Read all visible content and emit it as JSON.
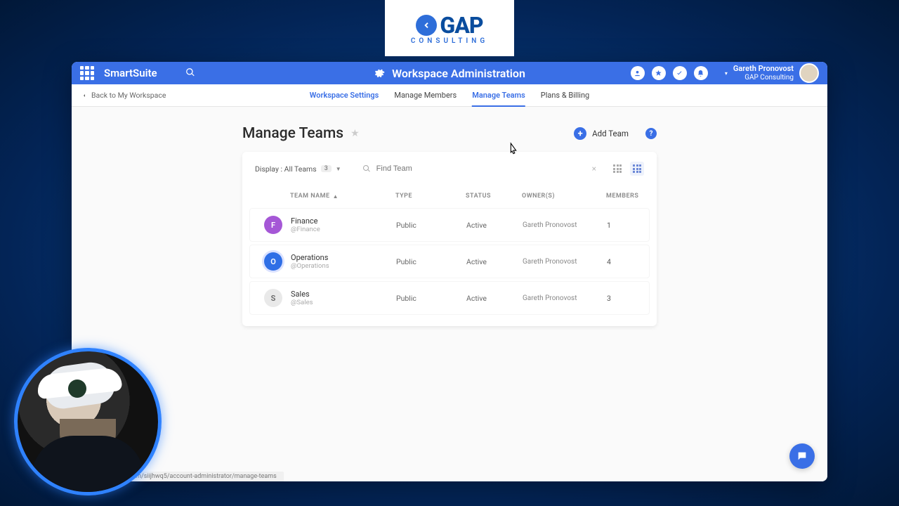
{
  "logo": {
    "name": "GAP",
    "sub": "CONSULTING"
  },
  "header": {
    "brand": "SmartSuite",
    "title": "Workspace Administration",
    "user_name": "Gareth Pronovost",
    "user_org": "GAP Consulting"
  },
  "back_label": "Back to My Workspace",
  "tabs": {
    "ws_settings": "Workspace Settings",
    "members": "Manage Members",
    "teams": "Manage Teams",
    "billing": "Plans & Billing"
  },
  "page": {
    "title": "Manage Teams",
    "add_label": "Add Team"
  },
  "filter": {
    "label": "Display : All Teams",
    "count": "3"
  },
  "search": {
    "placeholder": "Find Team"
  },
  "columns": {
    "name": "TEAM NAME",
    "type": "TYPE",
    "status": "STATUS",
    "owner": "OWNER(S)",
    "members": "MEMBERS"
  },
  "teams": [
    {
      "initial": "F",
      "color": "#a557d6",
      "name": "Finance",
      "handle": "@Finance",
      "type": "Public",
      "status": "Active",
      "owner": "Gareth Pronovost",
      "members": "1",
      "ring": false
    },
    {
      "initial": "O",
      "color": "#2f6fe6",
      "name": "Operations",
      "handle": "@Operations",
      "type": "Public",
      "status": "Active",
      "owner": "Gareth Pronovost",
      "members": "4",
      "ring": true
    },
    {
      "initial": "S",
      "color": "#e9e9e9",
      "name": "Sales",
      "handle": "@Sales",
      "type": "Public",
      "status": "Active",
      "owner": "Gareth Pronovost",
      "members": "3",
      "ring": false,
      "dark": true
    }
  ],
  "url_hint": "om/siijhwq5/account-administrator/manage-teams"
}
